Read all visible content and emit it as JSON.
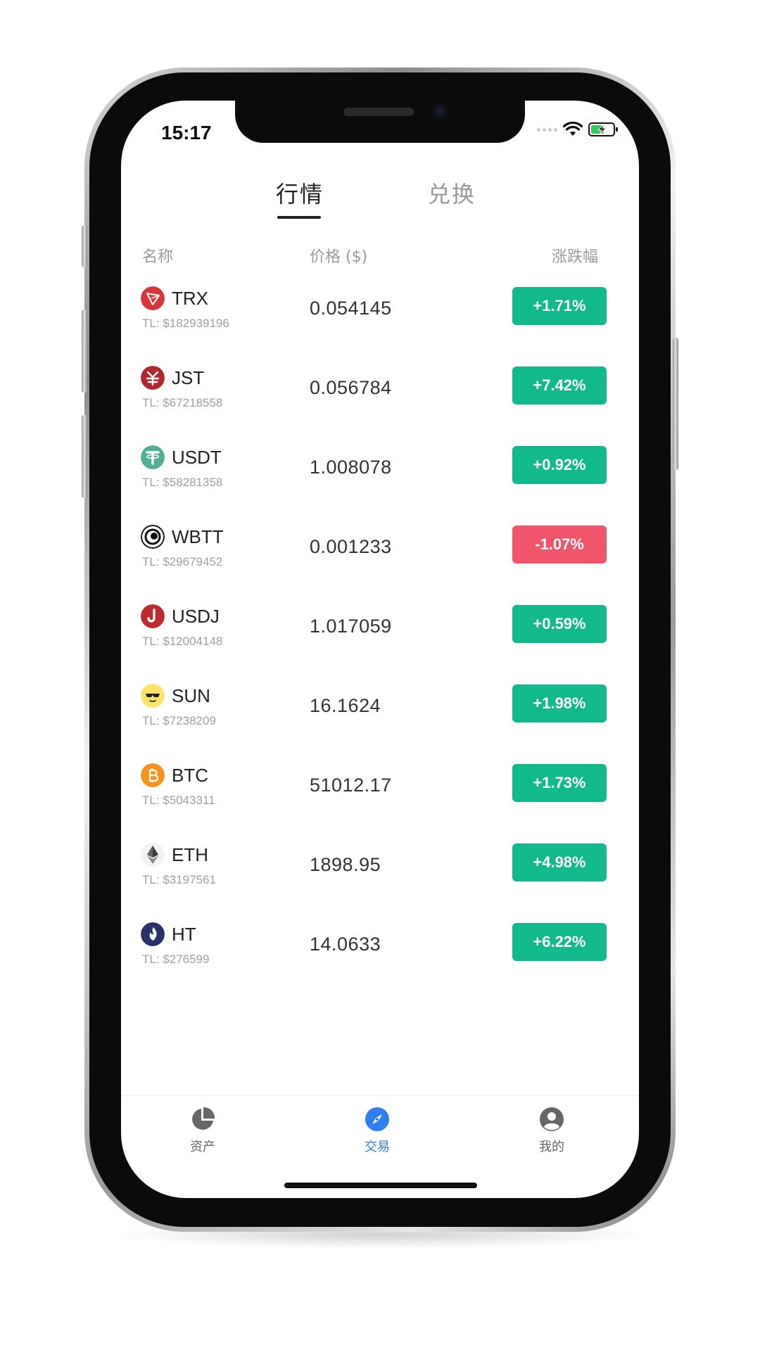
{
  "status_bar": {
    "time": "15:17"
  },
  "tabs": [
    {
      "label": "行情",
      "active": true
    },
    {
      "label": "兑换",
      "active": false
    }
  ],
  "table_header": {
    "name": "名称",
    "price": "价格 ($)",
    "change": "涨跌幅"
  },
  "coins": [
    {
      "symbol": "TRX",
      "tl": "TL: $182939196",
      "price": "0.054145",
      "change": "+1.71%",
      "direction": "up"
    },
    {
      "symbol": "JST",
      "tl": "TL: $67218558",
      "price": "0.056784",
      "change": "+7.42%",
      "direction": "up"
    },
    {
      "symbol": "USDT",
      "tl": "TL: $58281358",
      "price": "1.008078",
      "change": "+0.92%",
      "direction": "up"
    },
    {
      "symbol": "WBTT",
      "tl": "TL: $29679452",
      "price": "0.001233",
      "change": "-1.07%",
      "direction": "down"
    },
    {
      "symbol": "USDJ",
      "tl": "TL: $12004148",
      "price": "1.017059",
      "change": "+0.59%",
      "direction": "up"
    },
    {
      "symbol": "SUN",
      "tl": "TL: $7238209",
      "price": "16.1624",
      "change": "+1.98%",
      "direction": "up"
    },
    {
      "symbol": "BTC",
      "tl": "TL: $5043311",
      "price": "51012.17",
      "change": "+1.73%",
      "direction": "up"
    },
    {
      "symbol": "ETH",
      "tl": "TL: $3197561",
      "price": "1898.95",
      "change": "+4.98%",
      "direction": "up"
    },
    {
      "symbol": "HT",
      "tl": "TL: $276599",
      "price": "14.0633",
      "change": "+6.22%",
      "direction": "up"
    }
  ],
  "bottom_nav": [
    {
      "label": "资产",
      "icon": "pie-chart-icon",
      "active": false
    },
    {
      "label": "交易",
      "icon": "compass-icon",
      "active": true
    },
    {
      "label": "我的",
      "icon": "user-icon",
      "active": false
    }
  ],
  "colors": {
    "up": "#12b98a",
    "down": "#f0556b",
    "nav_active": "#2f7ff0",
    "nav_inactive": "#666666"
  }
}
